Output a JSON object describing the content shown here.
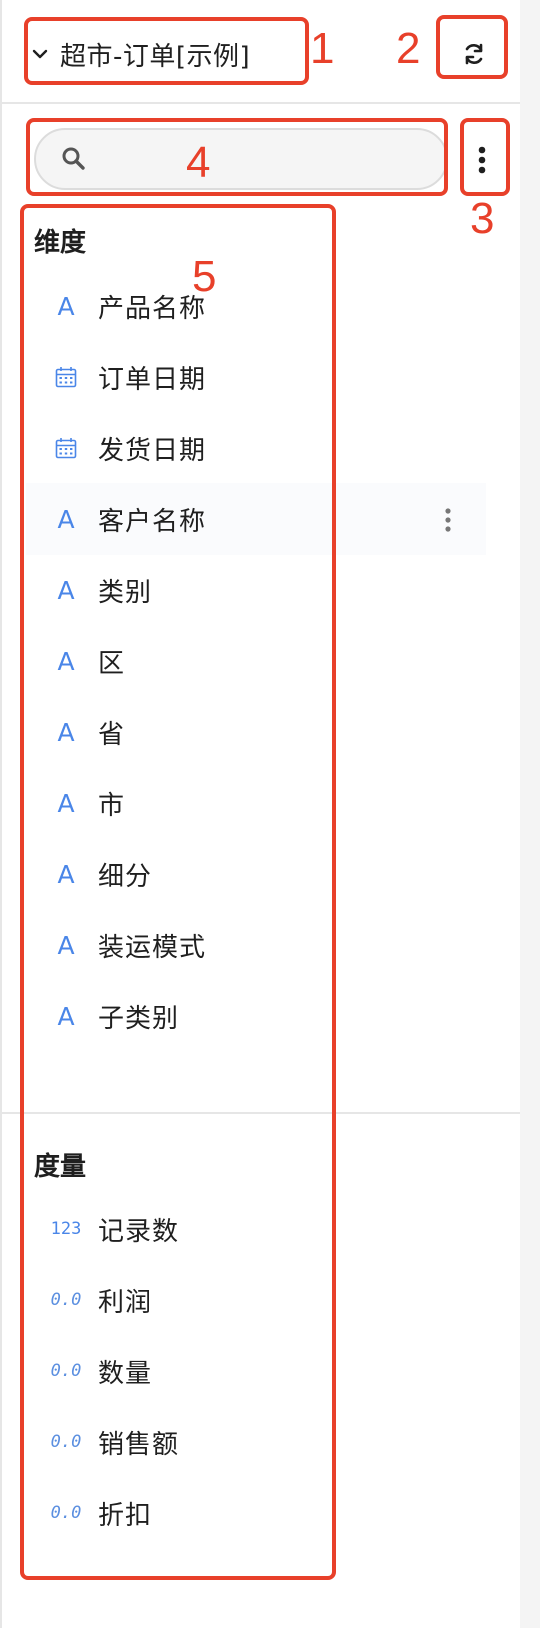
{
  "datasource": {
    "name": "超市-订单[示例]"
  },
  "search": {
    "value": "",
    "placeholder": ""
  },
  "dimensions": {
    "title": "维度",
    "items": [
      {
        "label": "产品名称",
        "type": "text",
        "type_glyph": "A"
      },
      {
        "label": "订单日期",
        "type": "date",
        "type_glyph": "calendar"
      },
      {
        "label": "发货日期",
        "type": "date",
        "type_glyph": "calendar"
      },
      {
        "label": "客户名称",
        "type": "text",
        "type_glyph": "A",
        "hovered": true
      },
      {
        "label": "类别",
        "type": "text",
        "type_glyph": "A"
      },
      {
        "label": "区",
        "type": "text",
        "type_glyph": "A"
      },
      {
        "label": "省",
        "type": "text",
        "type_glyph": "A"
      },
      {
        "label": "市",
        "type": "text",
        "type_glyph": "A"
      },
      {
        "label": "细分",
        "type": "text",
        "type_glyph": "A"
      },
      {
        "label": "装运模式",
        "type": "text",
        "type_glyph": "A"
      },
      {
        "label": "子类别",
        "type": "text",
        "type_glyph": "A"
      }
    ]
  },
  "measures": {
    "title": "度量",
    "items": [
      {
        "label": "记录数",
        "type": "integer",
        "type_glyph": "123"
      },
      {
        "label": "利润",
        "type": "decimal",
        "type_glyph": "0.0"
      },
      {
        "label": "数量",
        "type": "decimal",
        "type_glyph": "0.0"
      },
      {
        "label": "销售额",
        "type": "decimal",
        "type_glyph": "0.0"
      },
      {
        "label": "折扣",
        "type": "decimal",
        "type_glyph": "0.0"
      }
    ]
  },
  "annotations": [
    "1",
    "2",
    "3",
    "4",
    "5"
  ],
  "colors": {
    "annotation": "#e8402a",
    "field_type_icon": "#4a86e8",
    "divider": "#e6e6e6",
    "search_bg": "#f5f5f5"
  },
  "icons": {
    "datasource_toggle": "chevron-down-icon",
    "refresh": "refresh-icon",
    "search": "search-icon",
    "more": "more-vertical-icon",
    "text_field": "text-type-icon",
    "date_field": "calendar-icon",
    "number_field": "number-type-icon"
  }
}
